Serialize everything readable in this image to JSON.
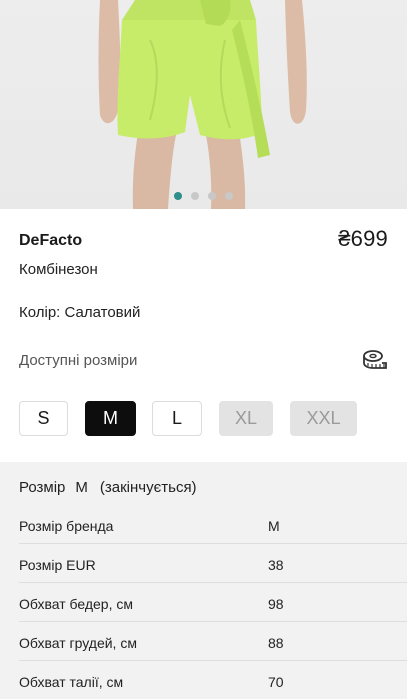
{
  "gallery": {
    "image_icon": "product-photo-green-shorts",
    "dots_count": 4,
    "active_dot": 0,
    "colors": {
      "active_dot": "#2f8f8a",
      "inactive_dot": "#c8c8c8",
      "garment": "#c6ec6a"
    }
  },
  "product": {
    "brand": "DeFacto",
    "price": "₴699",
    "name": "Комбінезон",
    "color_label": "Колір: Салатовий"
  },
  "sizes": {
    "title": "Доступні розміри",
    "chart_icon": "measuring-tape-icon",
    "options": [
      {
        "label": "S",
        "state": "available"
      },
      {
        "label": "M",
        "state": "selected"
      },
      {
        "label": "L",
        "state": "available"
      },
      {
        "label": "XL",
        "state": "unavailable"
      },
      {
        "label": "XXL",
        "state": "unavailable"
      }
    ]
  },
  "details": {
    "size_label": "Розмір",
    "size_value": "M",
    "size_note": "(закінчується)",
    "rows": [
      {
        "key": "Розмір бренда",
        "value": "M"
      },
      {
        "key": "Розмір EUR",
        "value": "38"
      },
      {
        "key": "Обхват бедер, см",
        "value": "98"
      },
      {
        "key": "Обхват грудей, см",
        "value": "88"
      },
      {
        "key": "Обхват талії, см",
        "value": "70"
      }
    ]
  }
}
